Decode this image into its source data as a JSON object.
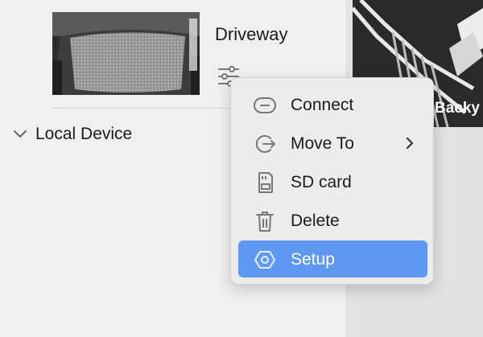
{
  "device": {
    "name": "Driveway",
    "icon": "sliders-icon"
  },
  "section": {
    "title": "Local Device",
    "icon": "chevron-down-icon"
  },
  "camera_preview": {
    "label": "Backy"
  },
  "context_menu": {
    "items": [
      {
        "label": "Connect",
        "icon": "connect-icon"
      },
      {
        "label": "Move To",
        "icon": "move-to-icon",
        "has_submenu": true
      },
      {
        "label": "SD card",
        "icon": "sd-card-icon"
      },
      {
        "label": "Delete",
        "icon": "trash-icon"
      },
      {
        "label": "Setup",
        "icon": "hexagon-settings-icon",
        "active": true
      }
    ],
    "active_color": "#5e98f3"
  }
}
